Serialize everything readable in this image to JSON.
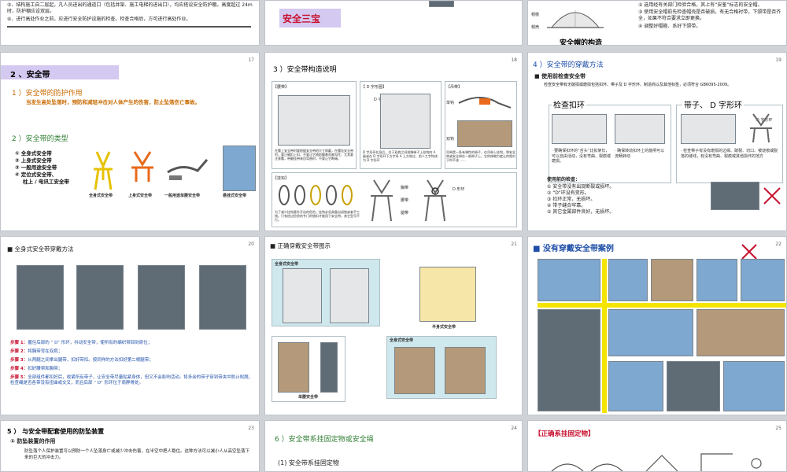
{
  "slides": {
    "s16": {
      "lines": [
        "⑤、结构施工自二层起，凡人员进出的通道口（包括井架、施工电梯的进出口），均应搭设安全防护棚。高度超过 24m 时，防护棚应设双层。",
        "⑥、进行高处作业之前，应进行安全防护设施的检查。检查合格后，方可进行高处作业。"
      ]
    },
    "s17_top": {
      "title": "安全三宝"
    },
    "s18_top": {
      "structure_title": "安全帽的构造",
      "labels": [
        "帽檐",
        "帽壳"
      ],
      "items": [
        "② 选用经有关部门检验合格，其上有“安鉴”标志的安全帽。",
        "③ 使用安全帽前先检查帽壳是否破损，有无合格衬带，下颌带是否齐全，如果不符合要求立即更换。",
        "④ 调整好帽箍、系好下颌带。"
      ]
    },
    "s17": {
      "num": "17",
      "heading": "2 、安全带",
      "sub1": "1 ）安全带的防护作用",
      "desc": "当发生高处坠落时，预防和减轻冲击对人体产生的伤害，防止坠落伤亡事故。",
      "sub2": "2 ）安全带的类型",
      "types": [
        "① 全身式安全带",
        "② 上身式安全带",
        "③ 一般用途安全带",
        "④ 定位式安全带、",
        "柱上 / 电讯工安全带"
      ],
      "captions": [
        "全身式安全带",
        "上身式安全带",
        "一般用途单腰安全带",
        "悬挂式安全带"
      ]
    },
    "s18": {
      "num": "18",
      "title": "3 ）安全带构造说明",
      "tags": [
        "【腰带】",
        "【 D 字形圈】",
        "【吊带】",
        "【挂钩】"
      ],
      "labels": [
        "D 字形",
        "单钩",
        "双钩",
        "D 形环",
        "胸带",
        "腰带",
        "腿带"
      ],
      "notes": [
        "在腰上安全带时要根据安全带的尺寸佩戴，在腰挂安全带时，要正确扣上扣，不要让它随前翻着而被勾住，尤其要注意腰，带腿挂带来回弯曲时，不要让它断绳。",
        "D 字形环在身后，位于双肩之间前胸带子上挂钩的 A 级或在 D 字形环下方字母 A 上方穿过，前人工字钩成为 D 字形环",
        "吊带是一条有弹性的带子，在吊带上挂钩，将安全带或安全带在一根带子上，它的伸缩力度让你相对于你不该 ......",
        "为了减少挂钩意外开启的危险，挂钩必须具备自闭锁或者手工锁。只有经过检验的专门的锁扣才能用于安全带，其它型号不行。"
      ]
    },
    "s19": {
      "num": "19",
      "title": "4 ）安全带的穿戴方法",
      "check_title": "■ 使用前检查安全带",
      "check_desc": "检查安全带有无破损或磨损包括扣环、带子及 D 字形环、制造商以及其他标签，必须符合 GB6095-2009。",
      "box1_title": "检查扣环",
      "box2_title": "带子、 D 字形环",
      "d_ring_label": "D 字形环",
      "box1_notes": [
        "· 要确保扣环的“舌头”比扣架长，可以自由活动，没有弯曲、裂痕或磨损。",
        "· 确保转动扣环上的旋闸可以流畅转动"
      ],
      "box2_note": "· 检查带子有没有磨损的边缘、破裂、切口、被烧痕或脱落的缝线，有没有弯曲、裂痕或其他损坏的地方",
      "pre_use_title": "使用前的检查：",
      "pre_use": [
        "① 安全带没有出现断裂或损坏。",
        "② “D”环没有变形。",
        "③ 扣环正常，无损坏。",
        "④ 带子缝合牢靠。",
        "⑤ 其它金属部件良好，无损坏。"
      ]
    },
    "s20": {
      "num": "20",
      "title": "■ 全身式安全带穿戴方法",
      "steps": [
        [
          "步骤 1：",
          "握住后部的 “ D” 形环，抖动安全带，使所有的编织带回到原位；"
        ],
        [
          "步骤 2：",
          "将胸带背在双肩；"
        ],
        [
          "步骤 3：",
          "从两腿之间拿出腿带，扣好带扣。按同样的方法扣好第二根腿带；"
        ],
        [
          "步骤 4：",
          "扣好腰带和胸带；"
        ],
        [
          "步骤 5：",
          "全部组件都扣好后，收紧所有带子，让安全带尽量贴紧身体，但又不会影响活动。将多余的带子穿到带夹中防止松脱，检查绳是否各带没有扭曲或交叉，而且后部 “ D” 形环位于肩胛骨处。"
        ]
      ]
    },
    "s21": {
      "num": "21",
      "title": "■ 正确穿戴安全带图示",
      "labels": [
        "全身式安全带",
        "半身式安全带",
        "单腰安全带",
        "全身式安全带"
      ]
    },
    "s22": {
      "num": "22",
      "title": "■ 没有穿戴安全带案例"
    },
    "s23": {
      "num": "23",
      "title": "5 ） 与安全带配套使用的防坠装置",
      "sub": "① 防坠装置的作用",
      "desc": "防坠落个人保护装置可以预防一个人坠落身亡或减少冲击伤害，在半空中把人稳住。这种方法可以减小人从高空坠落下来的巨大的冲击力。"
    },
    "s24": {
      "num": "24",
      "title": "6 ）安全带系挂固定物或安全绳",
      "sub": "(1) 安全带系挂固定物"
    },
    "s25": {
      "num": "25",
      "title": "【正确系挂固定物】"
    }
  },
  "colors": {
    "accent_purple": "#8e7cc3",
    "title_red": "#c8102e",
    "text_green": "#2e7d32",
    "text_orange": "#c86a00",
    "title_blue": "#1f4fa8",
    "yellow_bar": "#f5e400",
    "banner_purple": "#d4c9f0"
  }
}
